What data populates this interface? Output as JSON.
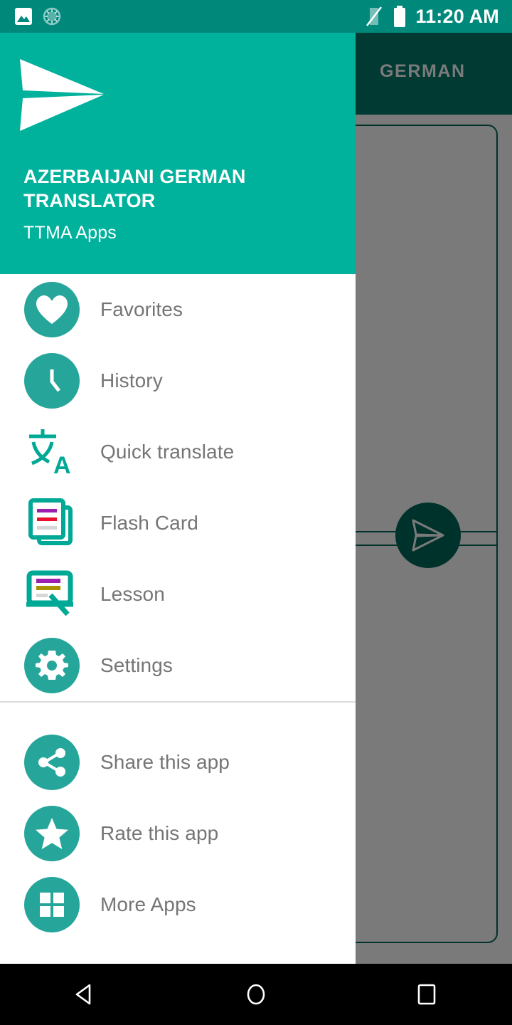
{
  "status_bar": {
    "time": "11:20 AM",
    "icons": [
      "image-icon",
      "spinner-icon",
      "no-sim-icon",
      "battery-icon"
    ],
    "background_color": "#00897B"
  },
  "background_app": {
    "tab_label": "GERMAN",
    "app_bar_color": "#00796B",
    "fab_icon": "send-icon",
    "fab_color": "#00695C"
  },
  "drawer": {
    "header": {
      "logo_icon": "send-plane-logo",
      "title": "AZERBAIJANI GERMAN TRANSLATOR",
      "subtitle": "TTMA Apps",
      "background_color": "#00B19B"
    },
    "primary_items": [
      {
        "label": "Favorites",
        "icon": "heart-icon",
        "style": "circle"
      },
      {
        "label": "History",
        "icon": "clock-icon",
        "style": "circle"
      },
      {
        "label": "Quick translate",
        "icon": "translate-icon",
        "style": "plain"
      },
      {
        "label": "Flash Card",
        "icon": "flash-card-icon",
        "style": "plain"
      },
      {
        "label": "Lesson",
        "icon": "lesson-board-icon",
        "style": "plain"
      },
      {
        "label": "Settings",
        "icon": "gear-icon",
        "style": "circle"
      }
    ],
    "secondary_items": [
      {
        "label": "Share this app",
        "icon": "share-icon",
        "style": "circle"
      },
      {
        "label": "Rate this app",
        "icon": "star-icon",
        "style": "circle"
      },
      {
        "label": "More Apps",
        "icon": "grid-apps-icon",
        "style": "circle"
      }
    ],
    "accent_color": "#26A69A",
    "label_color": "#757575"
  },
  "nav_bar": {
    "buttons": [
      {
        "name": "back-button",
        "icon": "triangle-back-icon"
      },
      {
        "name": "home-button",
        "icon": "circle-home-icon"
      },
      {
        "name": "recents-button",
        "icon": "square-recents-icon"
      }
    ]
  }
}
